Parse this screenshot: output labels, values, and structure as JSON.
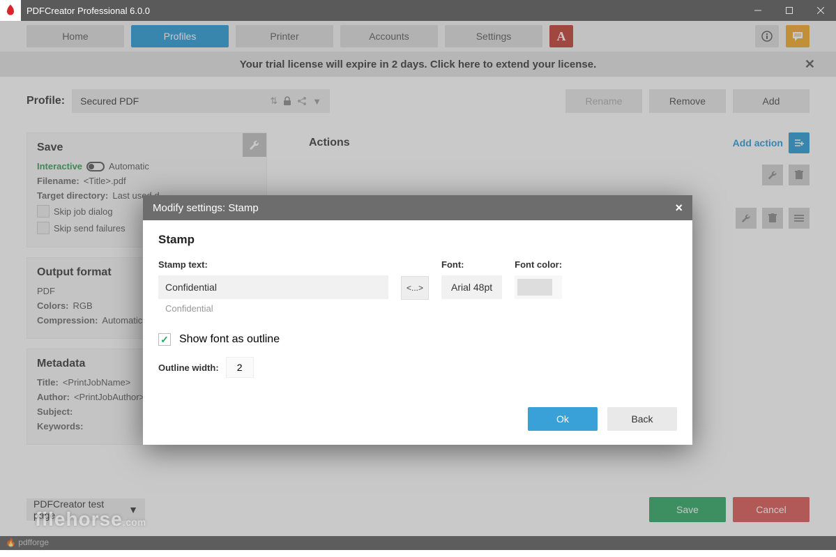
{
  "window": {
    "title": "PDFCreator Professional 6.0.0"
  },
  "nav": {
    "home": "Home",
    "profiles": "Profiles",
    "printer": "Printer",
    "accounts": "Accounts",
    "settings": "Settings"
  },
  "banner": {
    "text": "Your trial license will expire in 2 days. Click here to extend your license."
  },
  "profile": {
    "label": "Profile:",
    "selected": "Secured PDF",
    "rename": "Rename",
    "remove": "Remove",
    "add": "Add"
  },
  "save_panel": {
    "title": "Save",
    "interactive": "Interactive",
    "automatic": "Automatic",
    "filename_k": "Filename:",
    "filename_v": "<Title>.pdf",
    "target_k": "Target directory:",
    "target_v": "Last used d",
    "skip_job": "Skip job dialog",
    "skip_send": "Skip send failures"
  },
  "output_panel": {
    "title": "Output format",
    "format": "PDF",
    "colors_k": "Colors:",
    "colors_v": "RGB",
    "comp_k": "Compression:",
    "comp_v": "Automatic"
  },
  "metadata_panel": {
    "title": "Metadata",
    "title_k": "Title:",
    "title_v": "<PrintJobName>",
    "author_k": "Author:",
    "author_v": "<PrintJobAuthor>",
    "subject_k": "Subject:",
    "keywords_k": "Keywords:"
  },
  "actions": {
    "title": "Actions",
    "add": "Add action"
  },
  "bottom": {
    "testpage": "PDFCreator test page",
    "save": "Save",
    "cancel": "Cancel"
  },
  "footer": "pdfforge",
  "watermark": {
    "main": "filehorse",
    "suffix": ".com"
  },
  "modal": {
    "title": "Modify settings: Stamp",
    "heading": "Stamp",
    "stamp_text_lbl": "Stamp text:",
    "stamp_text_val": "Confidential",
    "stamp_text_hint": "Confidential",
    "token_btn": "<...>",
    "font_lbl": "Font:",
    "font_val": "Arial 48pt",
    "fontcolor_lbl": "Font color:",
    "show_outline": "Show font as outline",
    "outline_width_lbl": "Outline width:",
    "outline_width_val": "2",
    "ok": "Ok",
    "back": "Back"
  }
}
